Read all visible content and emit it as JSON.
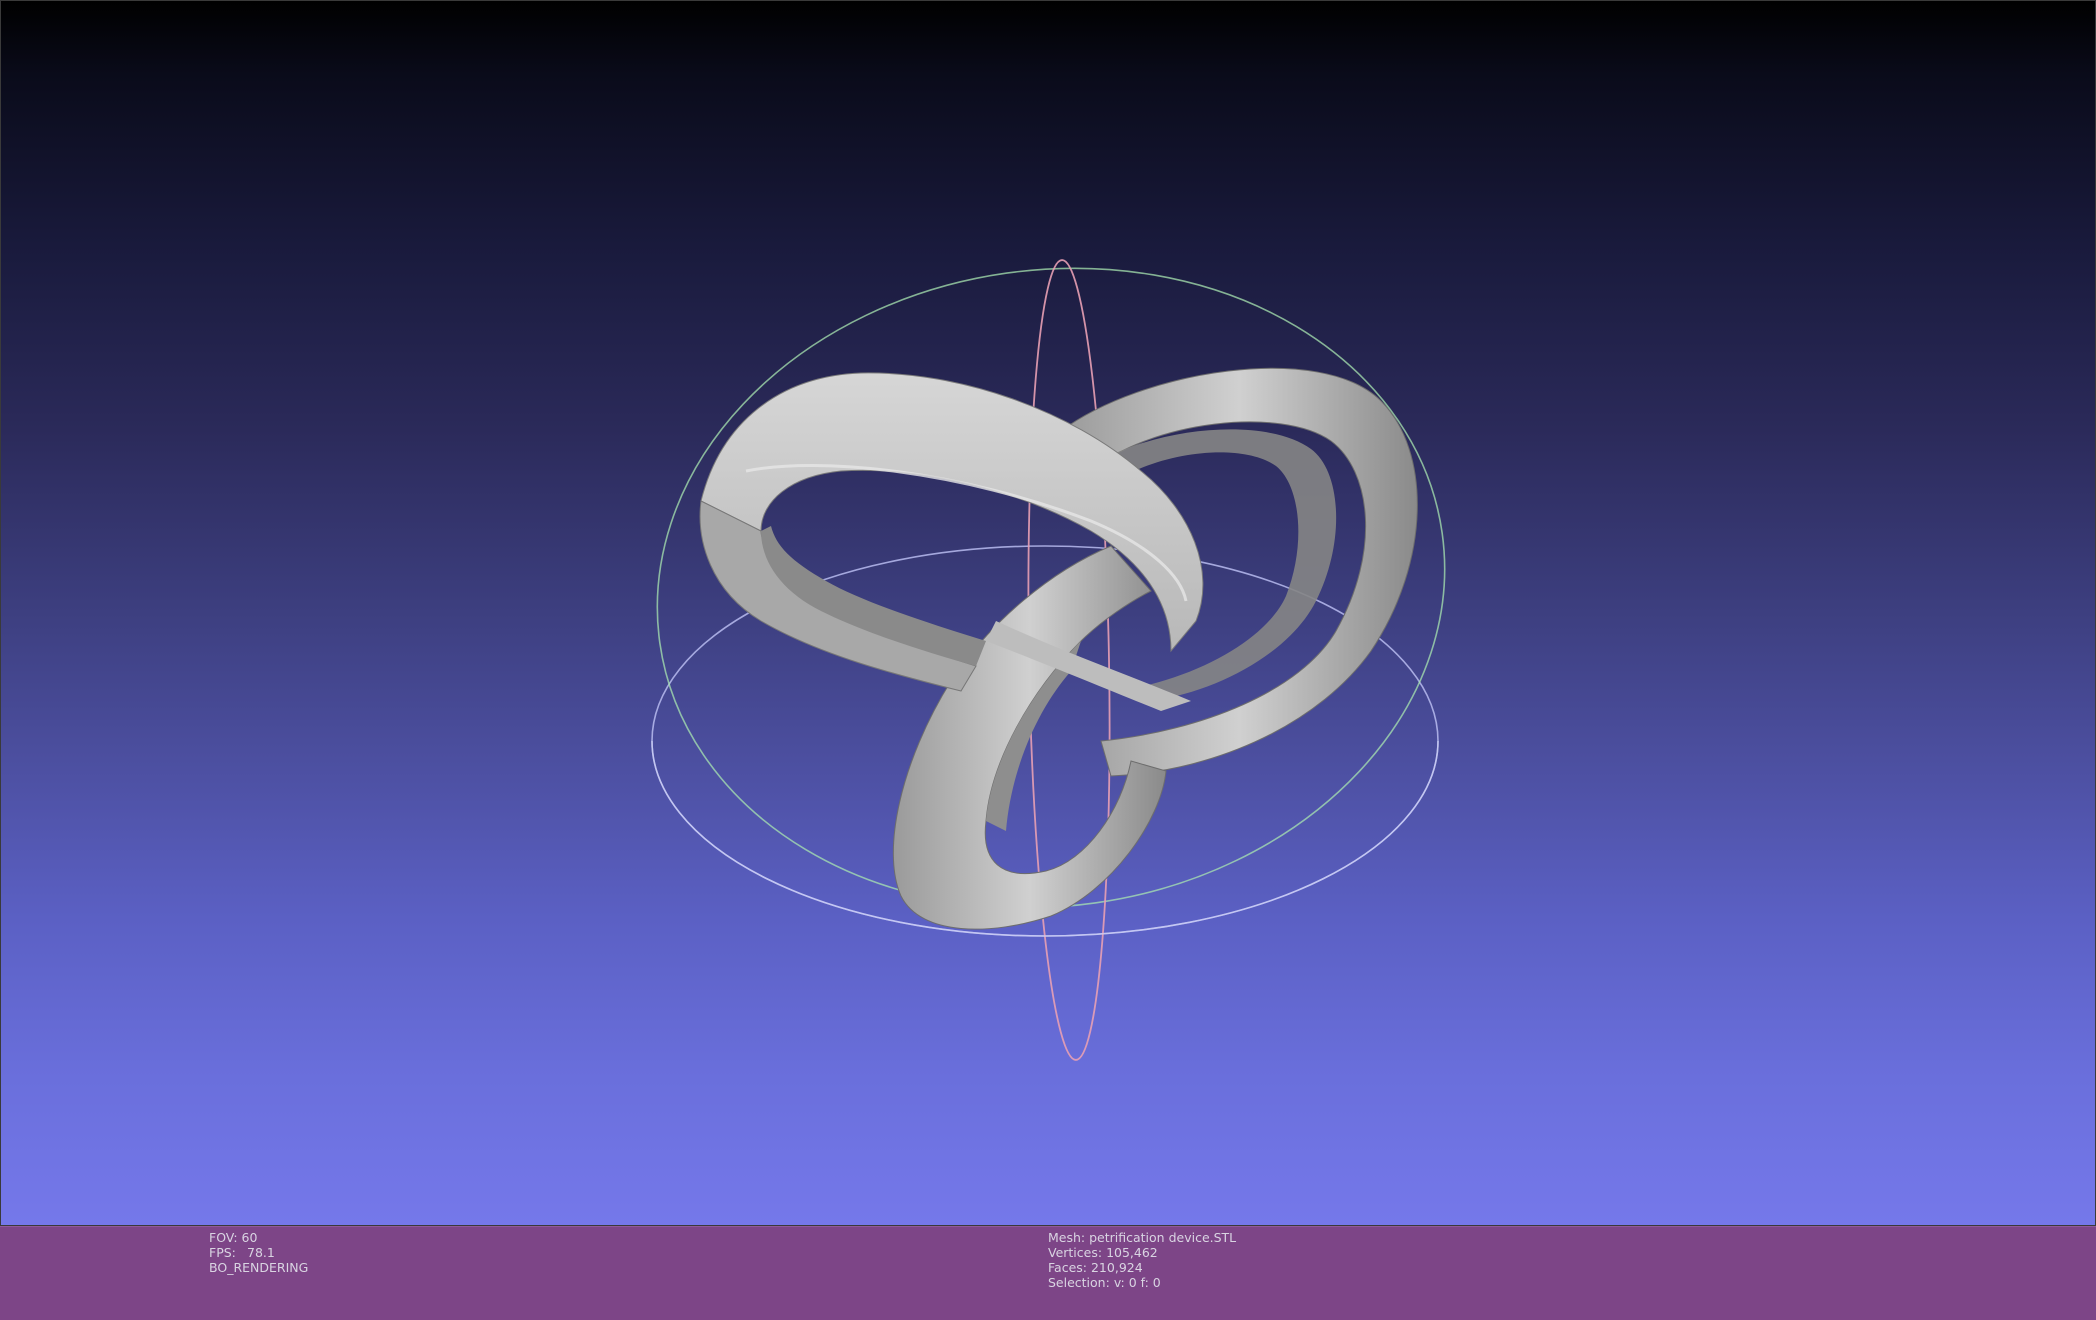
{
  "status_left": {
    "fov_label": "FOV:",
    "fov_value": "60",
    "fps_label": "FPS:",
    "fps_value": "78.1",
    "render_mode": "BO_RENDERING"
  },
  "status_right": {
    "mesh_label": "Mesh:",
    "mesh_value": "petrification device.STL",
    "vertices_label": "Vertices:",
    "vertices_value": "105,462",
    "faces_label": "Faces:",
    "faces_value": "210,924",
    "selection_label": "Selection:",
    "selection_value": "v: 0 f: 0"
  },
  "colors": {
    "status_bar_bg": "#7d4587",
    "mesh_color": "#c8c8c8",
    "trackball_x": "#e8a0b4",
    "trackball_y": "#a8e6b0",
    "trackball_z": "#b8bcf0"
  }
}
